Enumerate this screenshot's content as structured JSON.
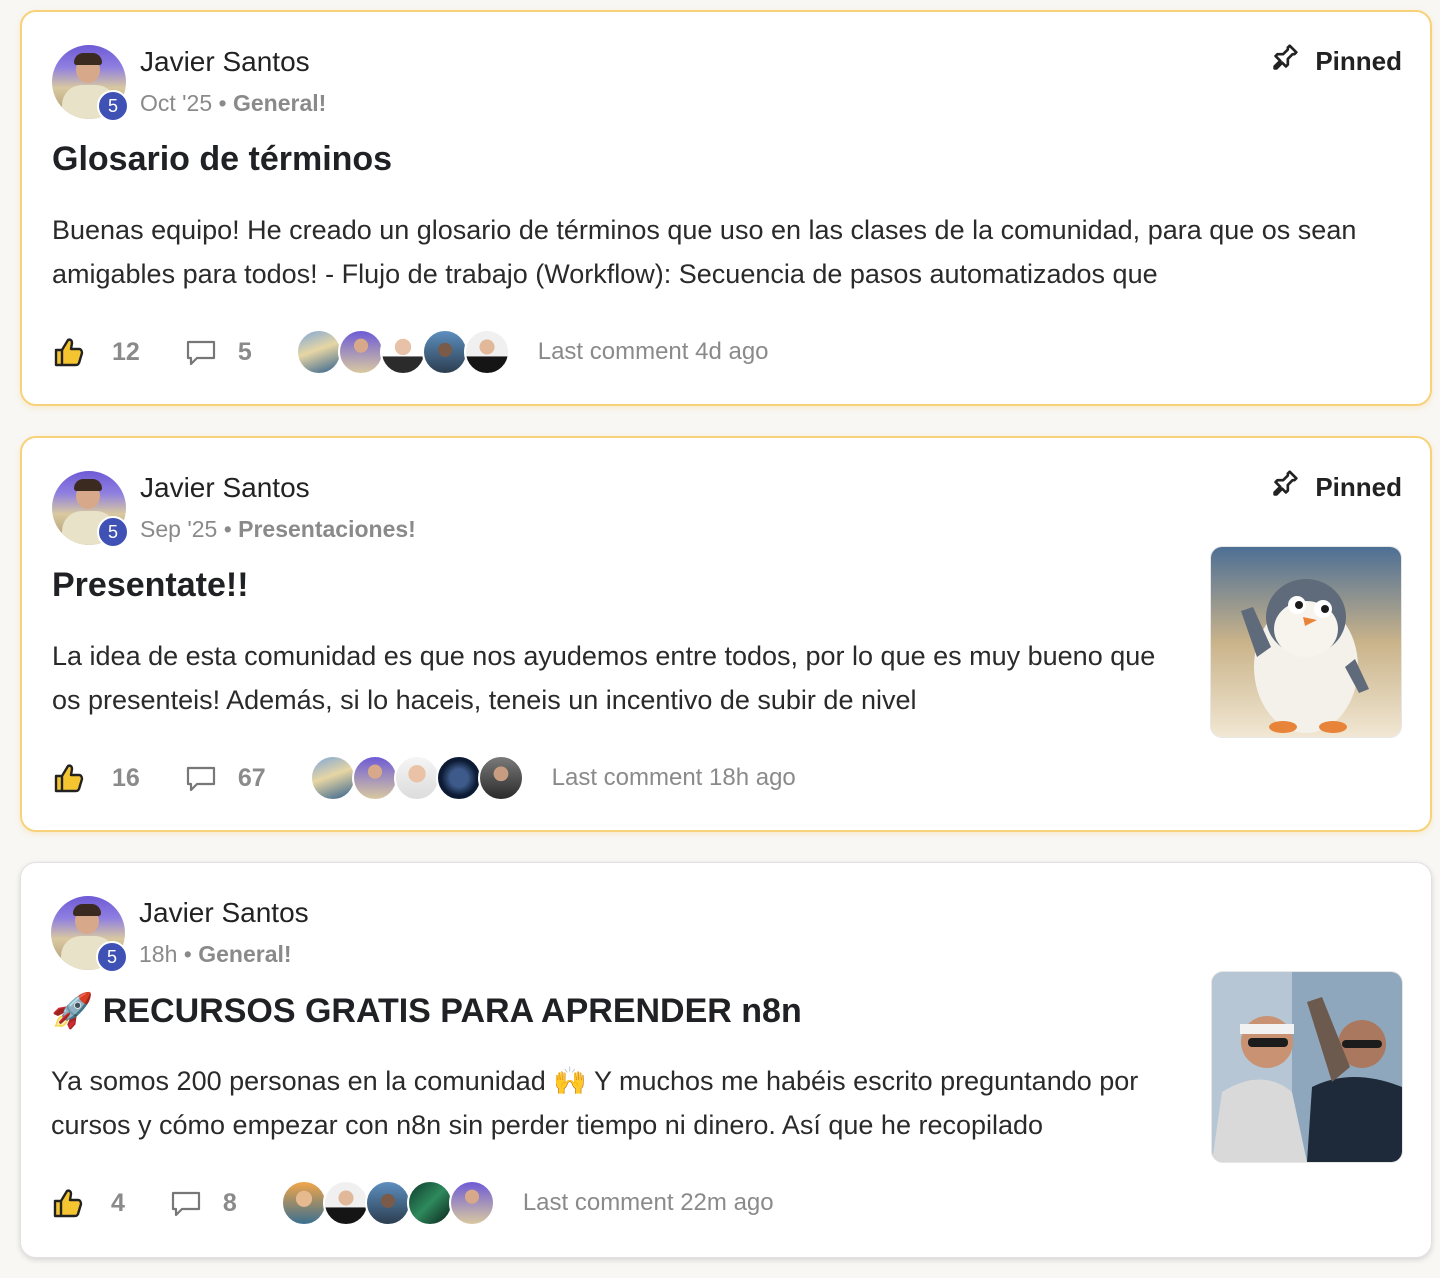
{
  "posts": [
    {
      "author": "Javier Santos",
      "level": "5",
      "date": "Oct '25",
      "separator": "•",
      "category": "General!",
      "pinned_label": "Pinned",
      "title_emoji": "",
      "title": "Glosario de términos",
      "excerpt": "Buenas equipo! He creado un glosario de términos que uso en las clases de la comunidad, para que os sean amigables para todos! - Flujo de trabajo (Workflow): Secuencia de pasos automatizados que",
      "likes": "12",
      "comments": "5",
      "last_comment": "Last comment 4d ago"
    },
    {
      "author": "Javier Santos",
      "level": "5",
      "date": "Sep '25",
      "separator": "•",
      "category": "Presentaciones!",
      "pinned_label": "Pinned",
      "title_emoji": "",
      "title": "Presentate!!",
      "excerpt": "La idea de esta comunidad es que nos ayudemos entre todos, por lo que es muy bueno que os presenteis! Además, si lo haceis, teneis un incentivo de subir de nivel",
      "likes": "16",
      "comments": "67",
      "last_comment": "Last comment 18h ago"
    },
    {
      "author": "Javier Santos",
      "level": "5",
      "date": "18h",
      "separator": "•",
      "category": "General!",
      "pinned_label": "",
      "title_emoji": "🚀",
      "title": "RECURSOS GRATIS PARA APRENDER n8n",
      "excerpt": "Ya somos 200 personas en la comunidad 🙌 Y muchos me habéis escrito preguntando por cursos y cómo empezar con n8n sin perder tiempo ni dinero. Así que he recopilado",
      "likes": "4",
      "comments": "8",
      "last_comment": "Last comment 22m ago"
    }
  ],
  "icons": {
    "pin": "pin-icon",
    "like": "thumbs-up-icon",
    "comment": "speech-bubble-icon"
  },
  "colors": {
    "pinned_border": "#f7d27a",
    "level_badge": "#3f51b5",
    "muted_text": "#8a8a8a"
  }
}
